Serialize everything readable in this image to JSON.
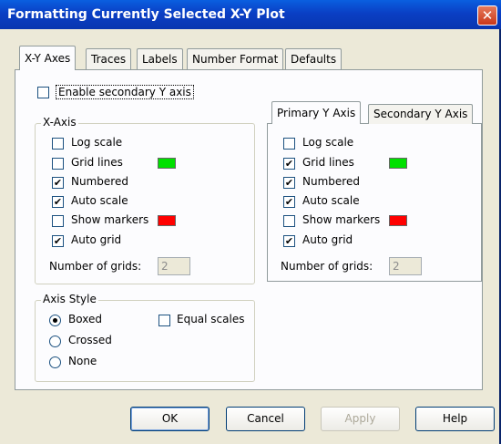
{
  "window": {
    "title": "Formatting Currently Selected X-Y Plot",
    "close_glyph": "✕"
  },
  "tabs": [
    {
      "label": "X-Y Axes",
      "active": true
    },
    {
      "label": "Traces",
      "active": false
    },
    {
      "label": "Labels",
      "active": false
    },
    {
      "label": "Number Format",
      "active": false
    },
    {
      "label": "Defaults",
      "active": false
    }
  ],
  "enable_secondary": {
    "label": "Enable secondary Y axis",
    "checked": false
  },
  "x_axis": {
    "title": "X-Axis",
    "options": [
      {
        "label": "Log scale",
        "checked": false
      },
      {
        "label": "Grid lines",
        "checked": false,
        "swatch": "#00E000"
      },
      {
        "label": "Numbered",
        "checked": true
      },
      {
        "label": "Auto scale",
        "checked": true
      },
      {
        "label": "Show markers",
        "checked": false,
        "swatch": "#FF0000"
      },
      {
        "label": "Auto grid",
        "checked": true
      }
    ],
    "grids_label": "Number of grids:",
    "grids_value": "2"
  },
  "y_tabs": [
    {
      "label": "Primary Y Axis",
      "active": true
    },
    {
      "label": "Secondary Y Axis",
      "active": false
    }
  ],
  "y_axis": {
    "options": [
      {
        "label": "Log scale",
        "checked": false
      },
      {
        "label": "Grid lines",
        "checked": true,
        "swatch": "#00E000"
      },
      {
        "label": "Numbered",
        "checked": true
      },
      {
        "label": "Auto scale",
        "checked": true
      },
      {
        "label": "Show markers",
        "checked": false,
        "swatch": "#FF0000"
      },
      {
        "label": "Auto grid",
        "checked": true
      }
    ],
    "grids_label": "Number of grids:",
    "grids_value": "2"
  },
  "axis_style": {
    "title": "Axis Style",
    "radios": [
      {
        "label": "Boxed",
        "selected": true
      },
      {
        "label": "Crossed",
        "selected": false
      },
      {
        "label": "None",
        "selected": false
      }
    ],
    "equal_scales": {
      "label": "Equal scales",
      "checked": false
    }
  },
  "buttons": {
    "ok": "OK",
    "cancel": "Cancel",
    "apply": "Apply",
    "help": "Help"
  }
}
